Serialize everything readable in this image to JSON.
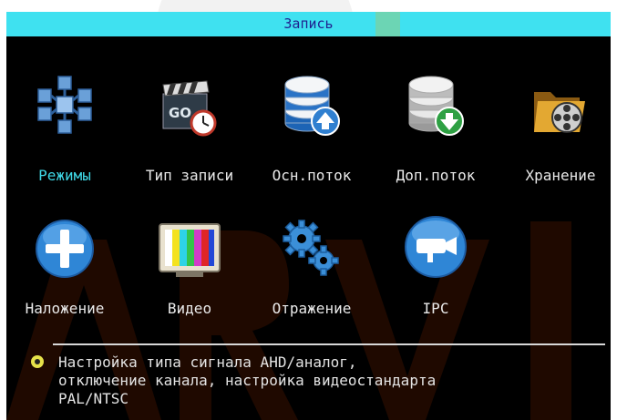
{
  "window": {
    "title": "Запись"
  },
  "menu": {
    "items": [
      {
        "label": "Режимы",
        "icon": "snowflake-cubes-icon",
        "selected": true
      },
      {
        "label": "Тип записи",
        "icon": "clapper-clock-icon",
        "selected": false
      },
      {
        "label": "Осн.поток",
        "icon": "database-upload-icon",
        "selected": false
      },
      {
        "label": "Доп.поток",
        "icon": "database-download-icon",
        "selected": false
      },
      {
        "label": "Хранение",
        "icon": "folder-film-icon",
        "selected": false
      },
      {
        "label": "Наложение",
        "icon": "plus-circle-icon",
        "selected": false
      },
      {
        "label": "Видео",
        "icon": "color-bars-tv-icon",
        "selected": false
      },
      {
        "label": "Отражение",
        "icon": "gears-icon",
        "selected": false
      },
      {
        "label": "IPC",
        "icon": "camera-circle-icon",
        "selected": false
      }
    ]
  },
  "hint": {
    "text": "Настройка типа сигнала AHD/аналог,\nотключение канала, настройка видеостандарта\nPAL/NTSC"
  },
  "colors": {
    "titlebar": "#3fe1f0",
    "panel": "#000000",
    "selected_label": "#3fd8e6",
    "label": "#e9e9e9",
    "watermark": "#f6b800"
  }
}
